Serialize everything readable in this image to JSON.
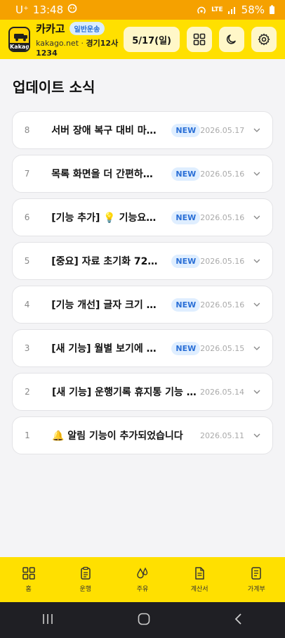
{
  "status_bar": {
    "carrier": "U⁺",
    "time": "13:48",
    "network": "LTE",
    "battery": "58%"
  },
  "header": {
    "logo_text": "Kakago",
    "app_name": "카카고",
    "badge": "일반운송",
    "site": "kakago.net",
    "separator": "·",
    "plate": "경기12사1234",
    "date_button": "5/17(일)"
  },
  "page": {
    "title": "업데이트 소식"
  },
  "updates": [
    {
      "num": "8",
      "title": "서버 장애 복구 대비 마련 …",
      "badge": "NEW",
      "date": "2026.05.17"
    },
    {
      "num": "7",
      "title": "목록 화면을 더 간편하게 …",
      "badge": "NEW",
      "date": "2026.05.16"
    },
    {
      "num": "6",
      "title": "[기능 추가] 💡 기능요청 …",
      "badge": "NEW",
      "date": "2026.05.16"
    },
    {
      "num": "5",
      "title": "[중요] 자료 초기화 72시…",
      "badge": "NEW",
      "date": "2026.05.16"
    },
    {
      "num": "4",
      "title": "[기능 개선] 글자 크기 설…",
      "badge": "NEW",
      "date": "2026.05.16"
    },
    {
      "num": "3",
      "title": "[새 기능] 월별 보기에 주…",
      "badge": "NEW",
      "date": "2026.05.15"
    },
    {
      "num": "2",
      "title": "[새 기능] 운행기록 휴지통 기능 추…",
      "badge": "",
      "date": "2026.05.14"
    },
    {
      "num": "1",
      "title": "🔔 알림 기능이 추가되었습니다",
      "badge": "",
      "date": "2026.05.11"
    }
  ],
  "bottom_nav": [
    {
      "label": "홈",
      "icon": "grid-icon"
    },
    {
      "label": "운행",
      "icon": "clipboard-icon"
    },
    {
      "label": "주유",
      "icon": "fuel-drop-icon"
    },
    {
      "label": "계산서",
      "icon": "document-icon"
    },
    {
      "label": "가계부",
      "icon": "ledger-icon"
    }
  ],
  "colors": {
    "status_bar": "#f5a100",
    "header": "#ffe000",
    "badge_blue": "#2a6fd6",
    "system_nav": "#1f1f24"
  }
}
